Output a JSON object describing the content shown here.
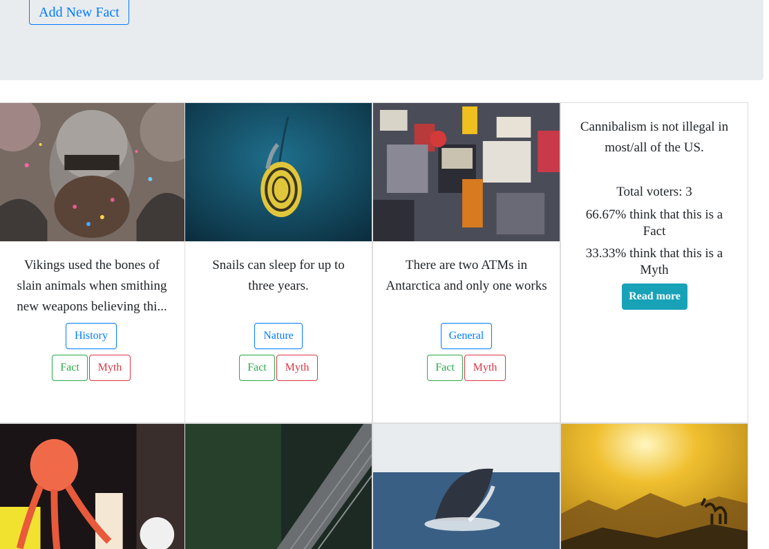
{
  "header": {
    "add_fact_label": "Add New Fact"
  },
  "cards": [
    {
      "text": "Vikings used the bones of slain animals when smithing new weapons believing thi...",
      "category": "History",
      "fact_label": "Fact",
      "myth_label": "Myth",
      "image": "viking-mask-photo"
    },
    {
      "text": "Snails can sleep for up to three years.",
      "category": "Nature",
      "fact_label": "Fact",
      "myth_label": "Myth",
      "image": "snail-photo"
    },
    {
      "text": "There are two ATMs in Antarctica and only one works",
      "category": "General",
      "fact_label": "Fact",
      "myth_label": "Myth",
      "image": "sticker-wall-atm-photo"
    }
  ],
  "stat_card": {
    "text": "Cannibalism is not illegal in most/all of the US.",
    "total_voters": "Total voters: 3",
    "fact_pct": "66.67% think that this is a Fact",
    "myth_pct": "33.33% think that this is a Myth",
    "read_more_label": "Read more"
  },
  "bottom_images": [
    "octopus-lantern-photo",
    "escalator-photo",
    "whale-breach-photo",
    "desert-camel-sunset-photo"
  ],
  "colors": {
    "primary": "#007bff",
    "success": "#28a745",
    "danger": "#dc3545",
    "info": "#17a2b8",
    "jumbotron": "#e9ecef"
  }
}
